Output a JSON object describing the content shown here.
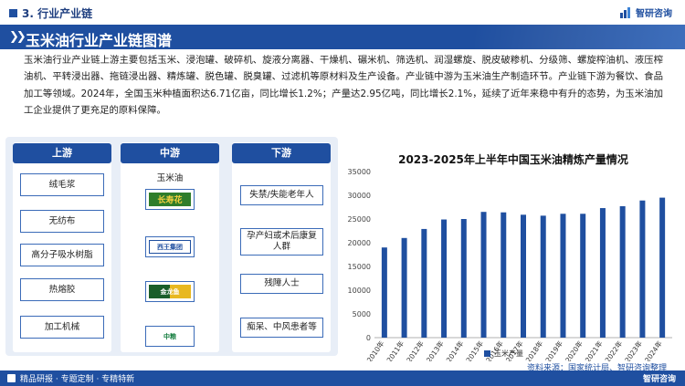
{
  "section": {
    "label": "3. 行业产业链"
  },
  "brand": {
    "name": "智研咨询"
  },
  "title": "玉米油行业产业链图谱",
  "intro": "玉米油行业产业链上游主要包括玉米、浸泡罐、破碎机、旋液分离器、干燥机、碾米机、筛选机、润湿螺旋、脱皮破糁机、分级筛、螺旋榨油机、液压榨油机、平转浸出器、拖链浸出器、精炼罐、脱色罐、脱臭罐、过滤机等原材料及生产设备。产业链中游为玉米油生产制造环节。产业链下游为餐饮、食品加工等领域。2024年，全国玉米种植面积达6.71亿亩，同比增长1.2%；产量达2.95亿吨，同比增长2.1%，延续了近年来稳中有升的态势，为玉米油加工企业提供了更充足的原料保障。",
  "chain": {
    "upstream": {
      "title": "上游",
      "items": [
        "绒毛浆",
        "无纺布",
        "高分子吸水树脂",
        "热熔胶",
        "加工机械"
      ]
    },
    "midstream": {
      "title": "中游",
      "label": "玉米油",
      "logos": [
        "长寿花",
        "西王集团",
        "金龙鱼",
        "中粮"
      ]
    },
    "downstream": {
      "title": "下游",
      "items": [
        "失禁/失能老年人",
        "孕产妇或术后康复人群",
        "残障人士",
        "痴呆、中风患者等"
      ]
    }
  },
  "chart_data": {
    "type": "bar",
    "title": "2023-2025年上半年中国玉米油精炼产量情况",
    "categories": [
      "2010年",
      "2011年",
      "2012年",
      "2013年",
      "2014年",
      "2015年",
      "2016年",
      "2017年",
      "2018年",
      "2019年",
      "2020年",
      "2021年",
      "2022年",
      "2023年",
      "2024年"
    ],
    "series": [
      {
        "name": "玉米产量",
        "values": [
          19000,
          21000,
          22900,
          24900,
          25000,
          26500,
          26400,
          25900,
          25700,
          26100,
          26100,
          27300,
          27700,
          28900,
          29500
        ]
      }
    ],
    "ylim": [
      0,
      35000
    ],
    "yticks": [
      "0",
      "5000",
      "10000",
      "15000",
      "20000",
      "25000",
      "30000",
      "35000"
    ],
    "grid": false,
    "legend": "bottom",
    "color": "#1f4fa0"
  },
  "source": "资料来源：国家统计局、智研咨询整理",
  "footer": {
    "text": "精品研报 · 专题定制 · 专精特新",
    "brand": "智研咨询"
  },
  "colors": {
    "primary": "#1f4fa0",
    "panel": "#e8eef7"
  }
}
